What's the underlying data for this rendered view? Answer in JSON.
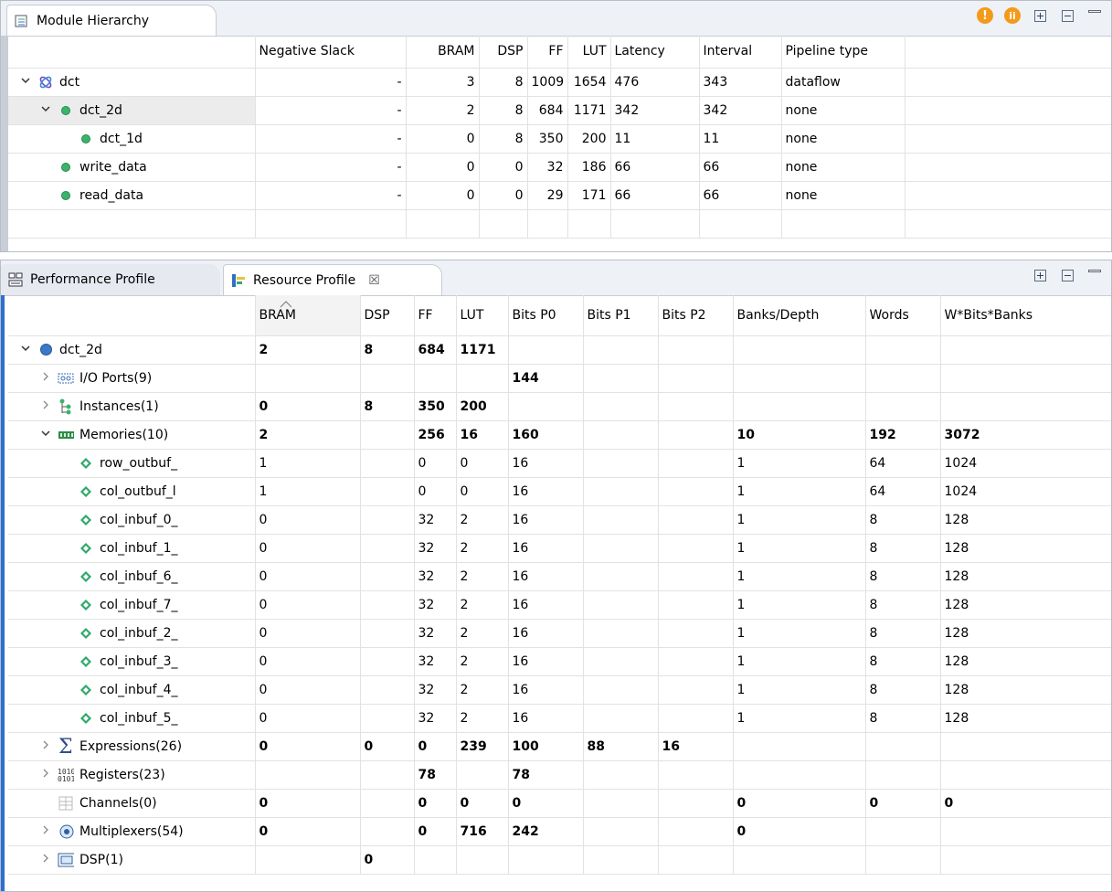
{
  "module_hierarchy": {
    "tab_label": "Module Hierarchy",
    "columns": [
      "",
      "Negative Slack",
      "BRAM",
      "DSP",
      "FF",
      "LUT",
      "Latency",
      "Interval",
      "Pipeline type"
    ],
    "rows": [
      {
        "name": "dct",
        "indent": 0,
        "expand": "open",
        "icon": "module-icon",
        "slack": "-",
        "bram": "3",
        "dsp": "8",
        "ff": "1009",
        "lut": "1654",
        "latency": "476",
        "interval": "343",
        "pipeline": "dataflow"
      },
      {
        "name": "dct_2d",
        "indent": 1,
        "expand": "open",
        "icon": "dot",
        "slack": "-",
        "bram": "2",
        "dsp": "8",
        "ff": "684",
        "lut": "1171",
        "latency": "342",
        "interval": "342",
        "pipeline": "none"
      },
      {
        "name": "dct_1d",
        "indent": 2,
        "expand": "",
        "icon": "dot",
        "slack": "-",
        "bram": "0",
        "dsp": "8",
        "ff": "350",
        "lut": "200",
        "latency": "11",
        "interval": "11",
        "pipeline": "none"
      },
      {
        "name": "write_data",
        "indent": 1,
        "expand": "",
        "icon": "dot",
        "slack": "-",
        "bram": "0",
        "dsp": "0",
        "ff": "32",
        "lut": "186",
        "latency": "66",
        "interval": "66",
        "pipeline": "none"
      },
      {
        "name": "read_data",
        "indent": 1,
        "expand": "",
        "icon": "dot",
        "slack": "-",
        "bram": "0",
        "dsp": "0",
        "ff": "29",
        "lut": "171",
        "latency": "66",
        "interval": "66",
        "pipeline": "none"
      }
    ]
  },
  "profile": {
    "tabs": [
      {
        "label": "Performance Profile",
        "active": false
      },
      {
        "label": "Resource Profile",
        "active": true
      }
    ],
    "close_glyph": "☒",
    "columns": [
      "",
      "BRAM",
      "DSP",
      "FF",
      "LUT",
      "Bits P0",
      "Bits P1",
      "Bits P2",
      "Banks/Depth",
      "Words",
      "W*Bits*Banks"
    ],
    "rows": [
      {
        "name": "dct_2d",
        "indent": 0,
        "expand": "open",
        "icon": "dot-blue",
        "bold": true,
        "cells": [
          "2",
          "8",
          "684",
          "1171",
          "",
          "",
          "",
          "",
          "",
          ""
        ]
      },
      {
        "name": "I/O Ports(9)",
        "indent": 1,
        "expand": "closed",
        "icon": "io-ports-icon",
        "bold": true,
        "cells": [
          "",
          "",
          "",
          "",
          "144",
          "",
          "",
          "",
          "",
          ""
        ]
      },
      {
        "name": "Instances(1)",
        "indent": 1,
        "expand": "closed",
        "icon": "instances-icon",
        "bold": true,
        "cells": [
          "0",
          "8",
          "350",
          "200",
          "",
          "",
          "",
          "",
          "",
          ""
        ]
      },
      {
        "name": "Memories(10)",
        "indent": 1,
        "expand": "open",
        "icon": "memory-icon",
        "bold": true,
        "cells": [
          "2",
          "",
          "256",
          "16",
          "160",
          "",
          "",
          "10",
          "192",
          "3072"
        ]
      },
      {
        "name": "row_outbuf_",
        "indent": 2,
        "expand": "",
        "icon": "diamond",
        "bold": false,
        "cells": [
          "1",
          "",
          "0",
          "0",
          "16",
          "",
          "",
          "1",
          "64",
          "1024"
        ]
      },
      {
        "name": "col_outbuf_l",
        "indent": 2,
        "expand": "",
        "icon": "diamond",
        "bold": false,
        "cells": [
          "1",
          "",
          "0",
          "0",
          "16",
          "",
          "",
          "1",
          "64",
          "1024"
        ]
      },
      {
        "name": "col_inbuf_0_",
        "indent": 2,
        "expand": "",
        "icon": "diamond",
        "bold": false,
        "cells": [
          "0",
          "",
          "32",
          "2",
          "16",
          "",
          "",
          "1",
          "8",
          "128"
        ]
      },
      {
        "name": "col_inbuf_1_",
        "indent": 2,
        "expand": "",
        "icon": "diamond",
        "bold": false,
        "cells": [
          "0",
          "",
          "32",
          "2",
          "16",
          "",
          "",
          "1",
          "8",
          "128"
        ]
      },
      {
        "name": "col_inbuf_6_",
        "indent": 2,
        "expand": "",
        "icon": "diamond",
        "bold": false,
        "cells": [
          "0",
          "",
          "32",
          "2",
          "16",
          "",
          "",
          "1",
          "8",
          "128"
        ]
      },
      {
        "name": "col_inbuf_7_",
        "indent": 2,
        "expand": "",
        "icon": "diamond",
        "bold": false,
        "cells": [
          "0",
          "",
          "32",
          "2",
          "16",
          "",
          "",
          "1",
          "8",
          "128"
        ]
      },
      {
        "name": "col_inbuf_2_",
        "indent": 2,
        "expand": "",
        "icon": "diamond",
        "bold": false,
        "cells": [
          "0",
          "",
          "32",
          "2",
          "16",
          "",
          "",
          "1",
          "8",
          "128"
        ]
      },
      {
        "name": "col_inbuf_3_",
        "indent": 2,
        "expand": "",
        "icon": "diamond",
        "bold": false,
        "cells": [
          "0",
          "",
          "32",
          "2",
          "16",
          "",
          "",
          "1",
          "8",
          "128"
        ]
      },
      {
        "name": "col_inbuf_4_",
        "indent": 2,
        "expand": "",
        "icon": "diamond",
        "bold": false,
        "cells": [
          "0",
          "",
          "32",
          "2",
          "16",
          "",
          "",
          "1",
          "8",
          "128"
        ]
      },
      {
        "name": "col_inbuf_5_",
        "indent": 2,
        "expand": "",
        "icon": "diamond",
        "bold": false,
        "cells": [
          "0",
          "",
          "32",
          "2",
          "16",
          "",
          "",
          "1",
          "8",
          "128"
        ]
      },
      {
        "name": "Expressions(26)",
        "indent": 1,
        "expand": "closed",
        "icon": "sigma-icon",
        "bold": true,
        "cells": [
          "0",
          "0",
          "0",
          "239",
          "100",
          "88",
          "16",
          "",
          "",
          ""
        ]
      },
      {
        "name": "Registers(23)",
        "indent": 1,
        "expand": "closed",
        "icon": "registers-icon",
        "bold": true,
        "cells": [
          "",
          "",
          "78",
          "",
          "78",
          "",
          "",
          "",
          "",
          ""
        ]
      },
      {
        "name": "Channels(0)",
        "indent": 1,
        "expand": "",
        "icon": "channels-icon",
        "bold": true,
        "cells": [
          "0",
          "",
          "0",
          "0",
          "0",
          "",
          "",
          "0",
          "0",
          "0"
        ]
      },
      {
        "name": "Multiplexers(54)",
        "indent": 1,
        "expand": "closed",
        "icon": "mux-icon",
        "bold": true,
        "cells": [
          "0",
          "",
          "0",
          "716",
          "242",
          "",
          "",
          "0",
          "",
          ""
        ]
      },
      {
        "name": "DSP(1)",
        "indent": 1,
        "expand": "closed",
        "icon": "dsp-icon",
        "bold": true,
        "cells": [
          "",
          "0",
          "",
          "",
          "",
          "",
          "",
          "",
          "",
          ""
        ]
      }
    ]
  }
}
